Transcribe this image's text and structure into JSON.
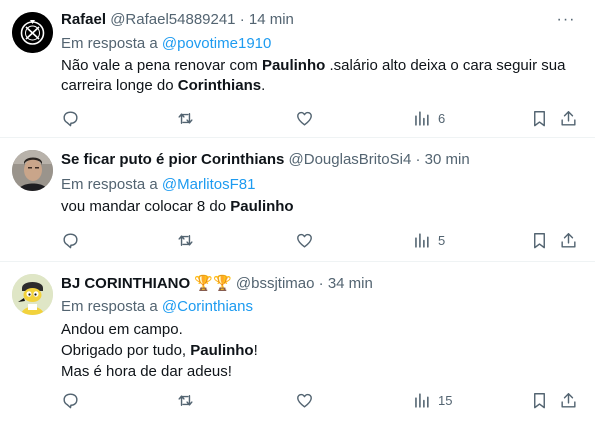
{
  "tweets": [
    {
      "name": "Rafael",
      "badges": "",
      "handle": "@Rafael54889241",
      "dot": "·",
      "time": "14 min",
      "reply_prefix": "Em resposta a",
      "reply_to": "@povotime1910",
      "lines": [
        [
          {
            "t": "Não vale a pena renovar com "
          },
          {
            "t": "Paulinho",
            "b": true
          },
          {
            "t": " .salário alto deixa o cara seguir sua"
          }
        ],
        [
          {
            "t": "carreira longe do "
          },
          {
            "t": "Corinthians",
            "b": true
          },
          {
            "t": "."
          }
        ]
      ],
      "views": "6"
    },
    {
      "name": "Se ficar puto é pior Corinthians",
      "badges": "",
      "handle": "@DouglasBritoSi4",
      "dot": "·",
      "time": "30 min",
      "reply_prefix": "Em resposta a",
      "reply_to": "@MarlitosF81",
      "lines": [
        [
          {
            "t": "vou mandar colocar 8 do "
          },
          {
            "t": "Paulinho",
            "b": true
          }
        ]
      ],
      "views": "5"
    },
    {
      "name": "BJ CORINTHIANO",
      "badges": "🏆🏆",
      "handle": "@bssjtimao",
      "dot": "·",
      "time": "34 min",
      "reply_prefix": "Em resposta a",
      "reply_to": "@Corinthians",
      "lines": [
        [
          {
            "t": "Andou em campo."
          }
        ],
        [
          {
            "t": "Obrigado por tudo, "
          },
          {
            "t": "Paulinho",
            "b": true
          },
          {
            "t": "!"
          }
        ],
        [
          {
            "t": "Mas é hora de dar adeus!"
          }
        ]
      ],
      "views": "15"
    }
  ],
  "more_label": "···",
  "colors": {
    "link": "#1d9bf0",
    "muted": "#536471",
    "text": "#0f1419",
    "divider": "#eff3f4"
  },
  "icons": [
    "reply-icon",
    "retweet-icon",
    "like-icon",
    "views-icon",
    "bookmark-icon",
    "share-icon",
    "more-icon"
  ]
}
